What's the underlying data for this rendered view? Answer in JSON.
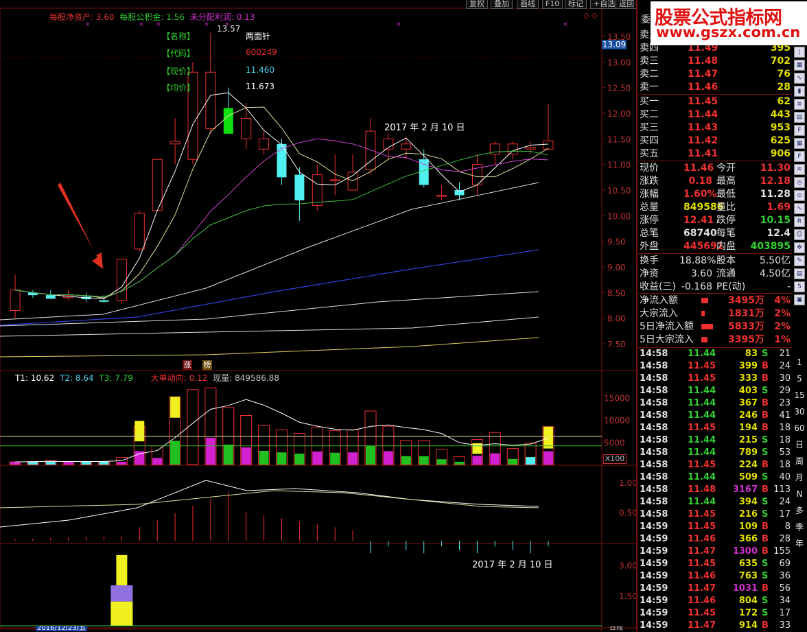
{
  "toolbar": {
    "buttons": [
      "复权",
      "叠加",
      "画线",
      "F10",
      "标记",
      "+自选",
      "返回"
    ]
  },
  "watermark": {
    "line1": "股票公式指标网",
    "line2": "www.gszx.com.cn"
  },
  "main_chart": {
    "fundamentals": [
      {
        "label": "每股净资产:",
        "value": "3.60"
      },
      {
        "label": "每股公积金:",
        "value": "1.56"
      },
      {
        "label": "未分配利润:",
        "value": "0.13"
      }
    ],
    "info_labels": [
      "【名称】",
      "【代码】",
      "【现价】",
      "【均价】"
    ],
    "info_values": [
      "两面针",
      "600249",
      "11.460",
      "11.673"
    ],
    "high_marker": "13.57",
    "date_note": "2017 年 2 月 10 日",
    "current_price_tag": "13.09",
    "y_ticks": [
      "13.50",
      "13.00",
      "12.50",
      "12.00",
      "11.50",
      "11.00",
      "10.50",
      "10.00",
      "9.50",
      "9.00",
      "8.50",
      "8.00",
      "7.50"
    ],
    "bottom_badges": [
      "涨",
      "榜"
    ]
  },
  "volume_panel": {
    "t1": "T1: 10.62",
    "t2": "T2: 8.64",
    "t3": "T3: 7.79",
    "big_order_label": "大单动向:",
    "big_order_value": "0.12",
    "volume_label": "现量:",
    "volume_value": "849586.88",
    "y_ticks": [
      "15000",
      "10000",
      "5000"
    ],
    "scale_label": "X100"
  },
  "indicator_panel": {
    "y_ticks": [
      "1.00",
      "0.50"
    ]
  },
  "signal_panel": {
    "y_ticks": [
      "3.00",
      "1.50"
    ],
    "date_note": "2017 年 2 月 10 日",
    "bottom_date": "2016/12/23/五",
    "bottom_right": "日线"
  },
  "order_book": {
    "header": "委",
    "sell": [
      {
        "label": "卖五",
        "price": "",
        "vol": ""
      },
      {
        "label": "卖四",
        "price": "11.49",
        "vol": "395"
      },
      {
        "label": "卖三",
        "price": "11.48",
        "vol": "702"
      },
      {
        "label": "卖二",
        "price": "11.47",
        "vol": "76"
      },
      {
        "label": "卖一",
        "price": "11.46",
        "vol": "28"
      }
    ],
    "buy": [
      {
        "label": "买一",
        "price": "11.45",
        "vol": "62"
      },
      {
        "label": "买二",
        "price": "11.44",
        "vol": "443"
      },
      {
        "label": "买三",
        "price": "11.43",
        "vol": "953"
      },
      {
        "label": "买四",
        "price": "11.42",
        "vol": "625"
      },
      {
        "label": "买五",
        "price": "11.41",
        "vol": "906"
      }
    ]
  },
  "quote": [
    {
      "l1": "现价",
      "v1": "11.46",
      "l2": "今开",
      "v2": "11.30"
    },
    {
      "l1": "涨跌",
      "v1": "0.18",
      "l2": "最高",
      "v2": "12.18"
    },
    {
      "l1": "涨幅",
      "v1": "1.60%",
      "l2": "最低",
      "v2": "11.28"
    },
    {
      "l1": "总量",
      "v1": "849586",
      "l2": "量比",
      "v2": "1.69"
    },
    {
      "l1": "涨停",
      "v1": "12.41",
      "l2": "跌停",
      "v2": "10.15"
    },
    {
      "l1": "总笔",
      "v1": "68740",
      "l2": "每笔",
      "v2": "12.4"
    },
    {
      "l1": "外盘",
      "v1": "445691",
      "l2": "内盘",
      "v2": "403895"
    }
  ],
  "stats": [
    {
      "l1": "换手",
      "v1": "18.88%",
      "l2": "股本",
      "v2": "5.50亿"
    },
    {
      "l1": "净资",
      "v1": "3.60",
      "l2": "流通",
      "v2": "4.50亿"
    },
    {
      "l1": "收益(三)",
      "v1": "-0.168",
      "l2": "PE(动)",
      "v2": "-"
    }
  ],
  "flows": [
    {
      "label": "净流入额",
      "value": "3495万",
      "pct": "4%",
      "ratio": 0.4
    },
    {
      "label": "大宗流入",
      "value": "1831万",
      "pct": "2%",
      "ratio": 0.2
    },
    {
      "label": "5日净流入额",
      "value": "5833万",
      "pct": "2%",
      "ratio": 0.65
    },
    {
      "label": "5日大宗流入",
      "value": "3395万",
      "pct": "1%",
      "ratio": 0.35
    }
  ],
  "trades": [
    {
      "time": "14:58",
      "price": "11.44",
      "vol": "83",
      "side": "S",
      "n": "21"
    },
    {
      "time": "14:58",
      "price": "11.45",
      "vol": "399",
      "side": "B",
      "n": "24"
    },
    {
      "time": "14:58",
      "price": "11.45",
      "vol": "333",
      "side": "B",
      "n": "30"
    },
    {
      "time": "14:58",
      "price": "11.44",
      "vol": "403",
      "side": "S",
      "n": "29"
    },
    {
      "time": "14:58",
      "price": "11.44",
      "vol": "367",
      "side": "B",
      "n": "23"
    },
    {
      "time": "14:58",
      "price": "11.44",
      "vol": "246",
      "side": "B",
      "n": "41"
    },
    {
      "time": "14:58",
      "price": "11.45",
      "vol": "194",
      "side": "B",
      "n": "18"
    },
    {
      "time": "14:58",
      "price": "11.44",
      "vol": "215",
      "side": "S",
      "n": "18"
    },
    {
      "time": "14:58",
      "price": "11.44",
      "vol": "789",
      "side": "S",
      "n": "53"
    },
    {
      "time": "14:58",
      "price": "11.45",
      "vol": "224",
      "side": "B",
      "n": "18"
    },
    {
      "time": "14:58",
      "price": "11.44",
      "vol": "509",
      "side": "S",
      "n": "40"
    },
    {
      "time": "14:58",
      "price": "11.48",
      "vol": "3167",
      "side": "B",
      "n": "113"
    },
    {
      "time": "14:58",
      "price": "11.44",
      "vol": "394",
      "side": "S",
      "n": "24"
    },
    {
      "time": "14:58",
      "price": "11.45",
      "vol": "216",
      "side": "S",
      "n": "17"
    },
    {
      "time": "14:59",
      "price": "11.45",
      "vol": "109",
      "side": "B",
      "n": "8"
    },
    {
      "time": "14:59",
      "price": "11.46",
      "vol": "366",
      "side": "B",
      "n": "28"
    },
    {
      "time": "14:59",
      "price": "11.47",
      "vol": "1300",
      "side": "B",
      "n": "155"
    },
    {
      "time": "14:59",
      "price": "11.45",
      "vol": "635",
      "side": "S",
      "n": "69"
    },
    {
      "time": "14:59",
      "price": "11.46",
      "vol": "763",
      "side": "S",
      "n": "36"
    },
    {
      "time": "14:59",
      "price": "11.47",
      "vol": "1031",
      "side": "B",
      "n": "56"
    },
    {
      "time": "14:59",
      "price": "11.46",
      "vol": "804",
      "side": "S",
      "n": "34"
    },
    {
      "time": "14:59",
      "price": "11.45",
      "vol": "172",
      "side": "S",
      "n": "17"
    },
    {
      "time": "14:59",
      "price": "11.47",
      "vol": "914",
      "side": "B",
      "n": "33"
    }
  ],
  "sidebar_icons": [
    "tick-icon",
    "grid-icon",
    "line-chart-icon",
    "bar-chart-icon",
    "list-icon",
    "doc-icon",
    "f10-icon",
    "table-icon",
    "f10b-icon",
    "lines-icon",
    "circle-icon",
    "target-icon",
    "wave-icon",
    "rsi-icon",
    "person-icon",
    "move-icon",
    "pen-icon",
    "doc2-icon",
    "f5-icon",
    "box-icon"
  ],
  "sidebar_periods": [
    "1",
    "5",
    "15",
    "30",
    "60",
    "日",
    "周",
    "月",
    "N",
    "多",
    "季",
    "年"
  ],
  "chart_data": {
    "type": "candlestick",
    "y_range": [
      7.3,
      13.7
    ],
    "candles": [
      {
        "o": 8.15,
        "h": 8.85,
        "l": 8.0,
        "c": 8.55,
        "v": 600,
        "vc": "magenta"
      },
      {
        "o": 8.5,
        "h": 8.55,
        "l": 8.4,
        "c": 8.45,
        "v": 700,
        "vc": "cyan"
      },
      {
        "o": 8.45,
        "h": 8.55,
        "l": 8.4,
        "c": 8.38,
        "v": 900,
        "vc": "cyan"
      },
      {
        "o": 8.4,
        "h": 8.55,
        "l": 8.35,
        "c": 8.45,
        "v": 600,
        "vc": "magenta"
      },
      {
        "o": 8.42,
        "h": 8.5,
        "l": 8.32,
        "c": 8.37,
        "v": 700,
        "vc": "cyan"
      },
      {
        "o": 8.35,
        "h": 8.45,
        "l": 8.3,
        "c": 8.32,
        "v": 600,
        "vc": "cyan"
      },
      {
        "o": 8.35,
        "h": 9.15,
        "l": 8.3,
        "c": 9.15,
        "v": 1600,
        "vc": "magenta"
      },
      {
        "o": 9.35,
        "h": 10.1,
        "l": 9.3,
        "c": 10.05,
        "v": 8600,
        "vc": "magenta"
      },
      {
        "o": 10.1,
        "h": 11.1,
        "l": 10.1,
        "c": 11.1,
        "v": 4200,
        "vc": "magenta"
      },
      {
        "o": 11.4,
        "h": 11.9,
        "l": 11.0,
        "c": 11.45,
        "v": 15200,
        "vc": "green"
      },
      {
        "o": 11.1,
        "h": 13.0,
        "l": 11.0,
        "c": 12.8,
        "v": 16800,
        "vc": "red"
      },
      {
        "o": 11.7,
        "h": 13.57,
        "l": 11.6,
        "c": 12.8,
        "v": 17200,
        "vc": "magenta"
      },
      {
        "o": 12.1,
        "h": 12.5,
        "l": 11.6,
        "c": 11.6,
        "v": 12800,
        "vc": "green"
      },
      {
        "o": 11.5,
        "h": 12.2,
        "l": 11.3,
        "c": 11.9,
        "v": 11000,
        "vc": "magenta"
      },
      {
        "o": 11.3,
        "h": 11.65,
        "l": 11.2,
        "c": 11.5,
        "v": 8800,
        "vc": "green"
      },
      {
        "o": 11.4,
        "h": 11.5,
        "l": 10.6,
        "c": 10.75,
        "v": 7800,
        "vc": "green"
      },
      {
        "o": 10.8,
        "h": 10.95,
        "l": 9.9,
        "c": 10.3,
        "v": 7000,
        "vc": "green"
      },
      {
        "o": 10.2,
        "h": 11.0,
        "l": 10.1,
        "c": 10.8,
        "v": 8400,
        "vc": "magenta"
      },
      {
        "o": 10.7,
        "h": 11.2,
        "l": 10.4,
        "c": 10.7,
        "v": 7600,
        "vc": "green"
      },
      {
        "o": 10.5,
        "h": 11.2,
        "l": 10.5,
        "c": 10.85,
        "v": 7800,
        "vc": "magenta"
      },
      {
        "o": 10.9,
        "h": 11.9,
        "l": 10.8,
        "c": 11.65,
        "v": 12000,
        "vc": "green"
      },
      {
        "o": 11.3,
        "h": 11.6,
        "l": 11.1,
        "c": 11.5,
        "v": 8600,
        "vc": "magenta"
      },
      {
        "o": 11.3,
        "h": 11.55,
        "l": 11.1,
        "c": 11.4,
        "v": 5400,
        "vc": "green"
      },
      {
        "o": 11.1,
        "h": 11.3,
        "l": 10.55,
        "c": 10.6,
        "v": 5400,
        "vc": "green"
      },
      {
        "o": 10.4,
        "h": 10.6,
        "l": 10.3,
        "c": 10.4,
        "v": 3400,
        "vc": "green"
      },
      {
        "o": 10.5,
        "h": 10.65,
        "l": 10.3,
        "c": 10.4,
        "v": 1800,
        "vc": "green"
      },
      {
        "o": 10.6,
        "h": 11.2,
        "l": 10.4,
        "c": 11.0,
        "v": 5600,
        "vc": "magenta"
      },
      {
        "o": 11.2,
        "h": 11.45,
        "l": 11.0,
        "c": 11.4,
        "v": 7200,
        "vc": "magenta"
      },
      {
        "o": 11.2,
        "h": 11.45,
        "l": 11.1,
        "c": 11.4,
        "v": 3600,
        "vc": "green"
      },
      {
        "o": 11.3,
        "h": 11.45,
        "l": 11.2,
        "c": 11.33,
        "v": 4800,
        "vc": "cyan"
      },
      {
        "o": 11.3,
        "h": 12.18,
        "l": 11.28,
        "c": 11.46,
        "v": 8500,
        "vc": "magenta"
      }
    ]
  }
}
